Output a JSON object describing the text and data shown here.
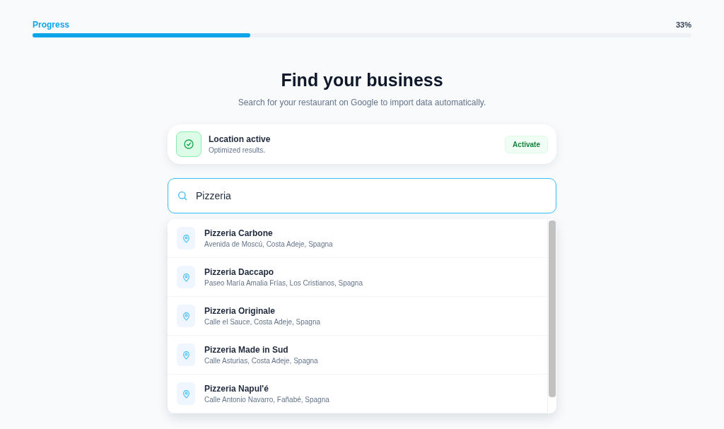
{
  "progress": {
    "label": "Progress",
    "reading": "33%",
    "level": 0.33
  },
  "header": {
    "title": "Find your business",
    "subtitle": "Search for your restaurant on Google to import data automatically."
  },
  "location": {
    "title": "Location active",
    "subtitle": "Optimized results.",
    "button": "Activate",
    "active": true
  },
  "search": {
    "value": "Pizzeria"
  },
  "results": [
    {
      "name": "Pizzeria Carbone",
      "address": "Avenida de Moscú, Costa Adeje, Spagna"
    },
    {
      "name": "Pizzeria Daccapo",
      "address": "Paseo María Amalia Frías, Los Cristianos, Spagna"
    },
    {
      "name": "Pizzeria Originale",
      "address": "Calle el Sauce, Costa Adeje, Spagna"
    },
    {
      "name": "Pizzeria Made in Sud",
      "address": "Calle Asturias, Costa Adeje, Spagna"
    },
    {
      "name": "Pizzeria Napul'é",
      "address": "Calle Antonio Navarro, Fañabé, Spagna"
    }
  ]
}
